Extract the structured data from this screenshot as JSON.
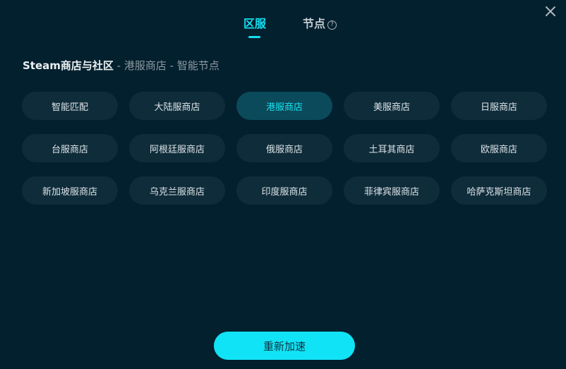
{
  "tabs": [
    {
      "label": "区服",
      "active": true
    },
    {
      "label": "节点",
      "active": false
    }
  ],
  "help_glyph": "?",
  "breadcrumb": {
    "main": "Steam商店与社区",
    "separator": " - ",
    "region": "港服商店",
    "node": "智能节点"
  },
  "regions": [
    {
      "label": "智能匹配",
      "selected": false
    },
    {
      "label": "大陆服商店",
      "selected": false
    },
    {
      "label": "港服商店",
      "selected": true
    },
    {
      "label": "美服商店",
      "selected": false
    },
    {
      "label": "日服商店",
      "selected": false
    },
    {
      "label": "台服商店",
      "selected": false
    },
    {
      "label": "阿根廷服商店",
      "selected": false
    },
    {
      "label": "俄服商店",
      "selected": false
    },
    {
      "label": "土耳其商店",
      "selected": false
    },
    {
      "label": "欧服商店",
      "selected": false
    },
    {
      "label": "新加坡服商店",
      "selected": false
    },
    {
      "label": "乌克兰服商店",
      "selected": false
    },
    {
      "label": "印度服商店",
      "selected": false
    },
    {
      "label": "菲律宾服商店",
      "selected": false
    },
    {
      "label": "哈萨克斯坦商店",
      "selected": false
    }
  ],
  "accelerate_label": "重新加速",
  "colors": {
    "accent": "#13e0f0",
    "background": "#03202e",
    "button": "#0f2c3a",
    "button_selected": "#0b4a5a"
  },
  "icons": {
    "close": "close-icon",
    "help": "help-icon"
  }
}
